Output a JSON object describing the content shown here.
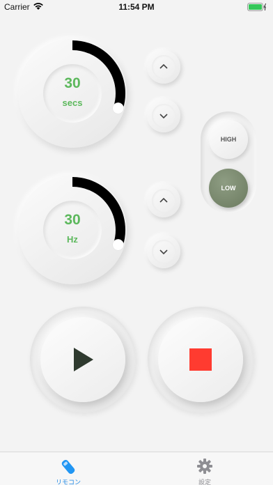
{
  "status_bar": {
    "carrier": "Carrier",
    "time": "11:54 PM"
  },
  "timer_dial": {
    "value": "30",
    "unit": "secs",
    "progress": 0.3
  },
  "frequency_dial": {
    "value": "30",
    "unit": "Hz",
    "progress": 0.3
  },
  "intensity": {
    "high_label": "HIGH",
    "low_label": "LOW",
    "selected": "LOW"
  },
  "controls": {
    "play_icon": "play-icon",
    "stop_icon": "stop-icon"
  },
  "tab_bar": {
    "tabs": [
      {
        "label": "リモコン",
        "icon": "remote-icon",
        "active": true
      },
      {
        "label": "設定",
        "icon": "gear-icon",
        "active": false
      }
    ]
  },
  "colors": {
    "value_text": "#5cb85c",
    "arc": "#000000",
    "stop": "#ff3b30",
    "play": "#2f3a2f",
    "low_selected": "#74826a",
    "tab_active": "#1e88e5",
    "tab_inactive": "#8e8e93"
  }
}
